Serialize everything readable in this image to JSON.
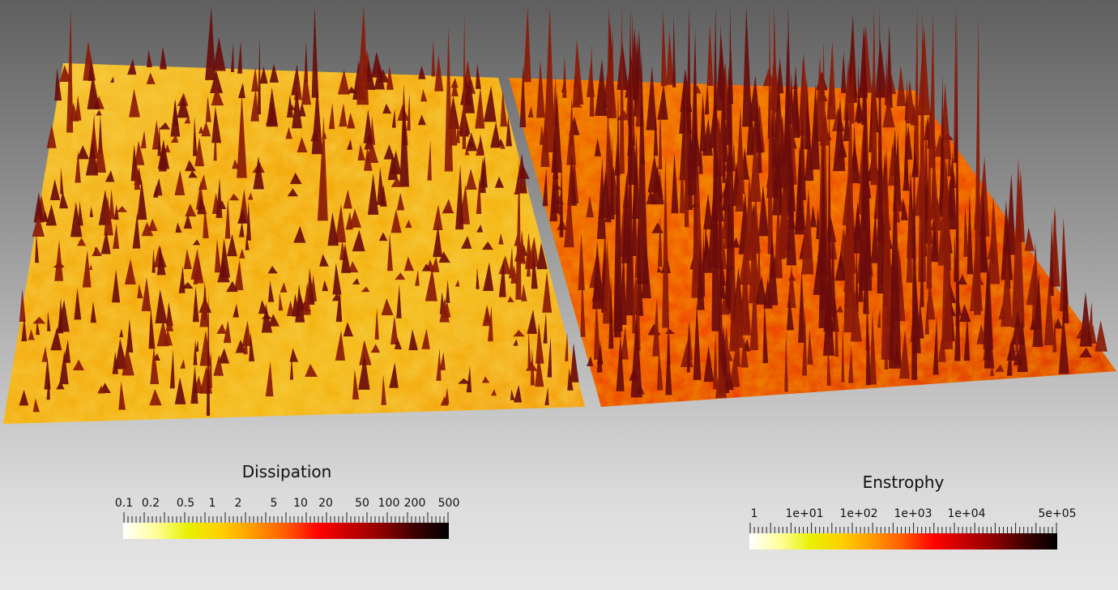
{
  "colors": {
    "hot_scale": [
      "#ffffff",
      "#ffff99",
      "#e8f000",
      "#ffd000",
      "#ff9a00",
      "#ff5a00",
      "#ff0000",
      "#c40000",
      "#8a0000",
      "#3a0000",
      "#000000"
    ],
    "surface_left": [
      "#fff6a0",
      "#ffe000",
      "#ffb000",
      "#ff7a00",
      "#d23a00",
      "#8a1200"
    ],
    "surface_right": [
      "#ffd45a",
      "#ffa000",
      "#ff6a00",
      "#ff2a00",
      "#c81000",
      "#7a0600"
    ],
    "spike": "#5a0a0a"
  },
  "legends": {
    "dissipation": {
      "title": "Dissipation",
      "tick_labels": [
        "0.1",
        "0.2",
        "0.5",
        "1",
        "2",
        "5",
        "10",
        "20",
        "50",
        "100",
        "200",
        "500"
      ]
    },
    "enstrophy": {
      "title": "Enstrophy",
      "tick_labels": [
        "1",
        "1e+01",
        "1e+02",
        "1e+03",
        "1e+04",
        "5e+05"
      ]
    }
  }
}
